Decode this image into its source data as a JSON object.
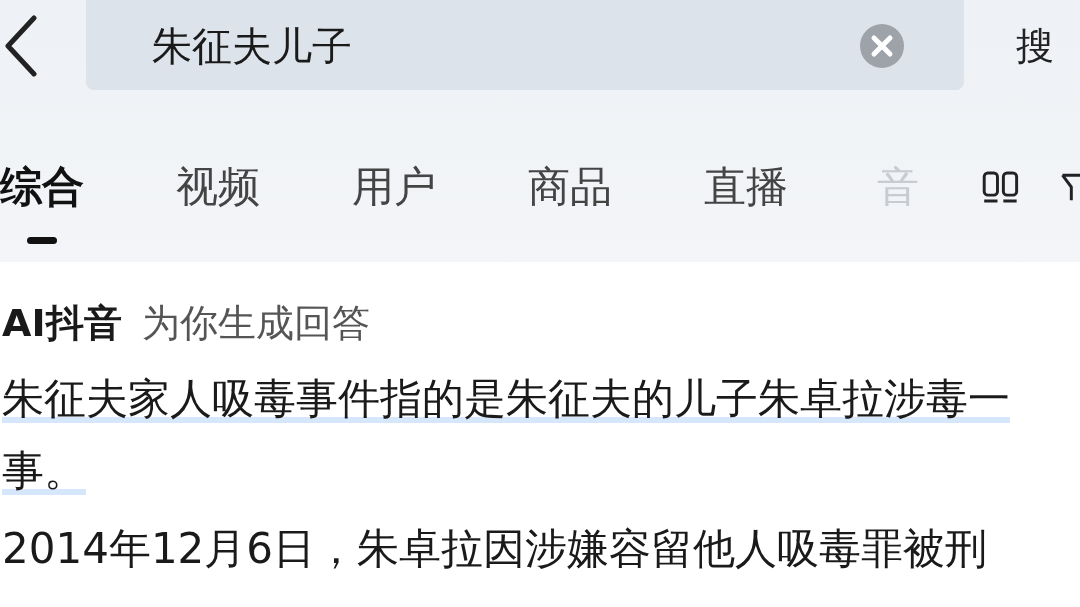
{
  "search": {
    "value": "朱征夫儿子",
    "button": "搜"
  },
  "tabs": [
    {
      "label": "综合",
      "selected": true,
      "faded": false
    },
    {
      "label": "视频",
      "selected": false,
      "faded": false
    },
    {
      "label": "用户",
      "selected": false,
      "faded": false
    },
    {
      "label": "商品",
      "selected": false,
      "faded": false
    },
    {
      "label": "直播",
      "selected": false,
      "faded": false
    },
    {
      "label": "音",
      "selected": false,
      "faded": true
    }
  ],
  "answer": {
    "brand": "AI抖音",
    "subtitle": "为你生成回答",
    "paragraphs": [
      {
        "text": "朱征夫家人吸毒事件指的是朱征夫的儿子朱卓拉涉毒一事。",
        "underlined": true
      },
      {
        "text": "2014年12月6日，朱卓拉因涉嫌容留他人吸毒罪被刑",
        "underlined": false
      }
    ]
  }
}
